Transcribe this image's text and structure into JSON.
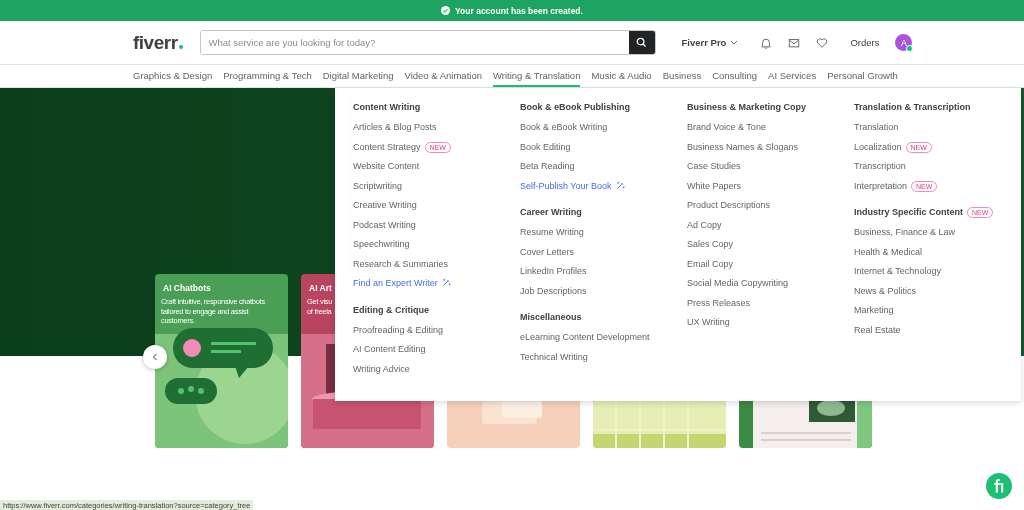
{
  "banner": {
    "message": "Your account has been created."
  },
  "header": {
    "logo": "fiverr",
    "search": {
      "placeholder": "What service are you looking for today?"
    },
    "pro_menu": "Fiverr Pro",
    "orders": "Orders",
    "avatar": {
      "initial": "A",
      "online": true
    }
  },
  "categories": [
    {
      "label": "Graphics & Design",
      "selected": false
    },
    {
      "label": "Programming & Tech",
      "selected": false
    },
    {
      "label": "Digital Marketing",
      "selected": false
    },
    {
      "label": "Video & Animation",
      "selected": false
    },
    {
      "label": "Writing & Translation",
      "selected": true
    },
    {
      "label": "Music & Audio",
      "selected": false
    },
    {
      "label": "Business",
      "selected": false
    },
    {
      "label": "Consulting",
      "selected": false
    },
    {
      "label": "AI Services",
      "selected": false
    },
    {
      "label": "Personal Growth",
      "selected": false
    }
  ],
  "mega_menu": {
    "columns": [
      {
        "groups": [
          {
            "title": "Content Writing",
            "items": [
              {
                "label": "Articles & Blog Posts",
                "kind": "item"
              },
              {
                "label": "Content Strategy",
                "kind": "item",
                "badge": "NEW"
              },
              {
                "label": "Website Content",
                "kind": "item"
              },
              {
                "label": "Scriptwriting",
                "kind": "item"
              },
              {
                "label": "Creative Writing",
                "kind": "item"
              },
              {
                "label": "Podcast Writing",
                "kind": "item"
              },
              {
                "label": "Speechwriting",
                "kind": "item"
              },
              {
                "label": "Research & Summaries",
                "kind": "item"
              },
              {
                "label": "Find an Expert Writer",
                "kind": "link"
              }
            ]
          },
          {
            "title": "Editing & Critique",
            "items": [
              {
                "label": "Proofreading & Editing",
                "kind": "item"
              },
              {
                "label": "AI Content Editing",
                "kind": "item"
              },
              {
                "label": "Writing Advice",
                "kind": "item"
              }
            ]
          }
        ]
      },
      {
        "groups": [
          {
            "title": "Book & eBook Publishing",
            "items": [
              {
                "label": "Book & eBook Writing",
                "kind": "item"
              },
              {
                "label": "Book Editing",
                "kind": "item"
              },
              {
                "label": "Beta Reading",
                "kind": "item"
              },
              {
                "label": "Self-Publish Your Book",
                "kind": "link"
              }
            ]
          },
          {
            "title": "Career Writing",
            "items": [
              {
                "label": "Resume Writing",
                "kind": "item"
              },
              {
                "label": "Cover Letters",
                "kind": "item"
              },
              {
                "label": "LinkedIn Profiles",
                "kind": "item"
              },
              {
                "label": "Job Descriptions",
                "kind": "item"
              }
            ]
          },
          {
            "title": "Miscellaneous",
            "items": [
              {
                "label": "eLearning Content Development",
                "kind": "item"
              },
              {
                "label": "Technical Writing",
                "kind": "item"
              }
            ]
          }
        ]
      },
      {
        "groups": [
          {
            "title": "Business & Marketing Copy",
            "items": [
              {
                "label": "Brand Voice & Tone",
                "kind": "item"
              },
              {
                "label": "Business Names & Slogans",
                "kind": "item"
              },
              {
                "label": "Case Studies",
                "kind": "item"
              },
              {
                "label": "White Papers",
                "kind": "item"
              },
              {
                "label": "Product Descriptions",
                "kind": "item"
              },
              {
                "label": "Ad Copy",
                "kind": "item"
              },
              {
                "label": "Sales Copy",
                "kind": "item"
              },
              {
                "label": "Email Copy",
                "kind": "item"
              },
              {
                "label": "Social Media Copywriting",
                "kind": "item"
              },
              {
                "label": "Press Releases",
                "kind": "item"
              },
              {
                "label": "UX Writing",
                "kind": "item"
              }
            ]
          }
        ]
      },
      {
        "groups": [
          {
            "title": "Translation & Transcription",
            "items": [
              {
                "label": "Translation",
                "kind": "item"
              },
              {
                "label": "Localization",
                "kind": "item",
                "badge": "NEW"
              },
              {
                "label": "Transcription",
                "kind": "item"
              },
              {
                "label": "Interpretation",
                "kind": "item",
                "badge": "NEW"
              }
            ]
          },
          {
            "title": "Industry Specific Content",
            "badge": "NEW",
            "items": [
              {
                "label": "Business, Finance & Law",
                "kind": "item"
              },
              {
                "label": "Health & Medical",
                "kind": "item"
              },
              {
                "label": "Internet & Technology",
                "kind": "item"
              },
              {
                "label": "News & Politics",
                "kind": "item"
              },
              {
                "label": "Marketing",
                "kind": "item"
              },
              {
                "label": "Real Estate",
                "kind": "item"
              }
            ]
          }
        ]
      }
    ]
  },
  "cards": [
    {
      "kind": "picture",
      "title": "AI Chatbots",
      "lines": [
        "Craft intuitive, responsive chatbots",
        "tailored to engage and assist",
        "customers."
      ]
    },
    {
      "kind": "picture",
      "title": "AI Art",
      "lines": [
        "Get visu",
        "of freela"
      ]
    },
    {
      "kind": "picture"
    },
    {
      "kind": "picture"
    },
    {
      "kind": "picture"
    }
  ],
  "status_url": "https://www.fiverr.com/categories/writing-translation?source=category_tree"
}
